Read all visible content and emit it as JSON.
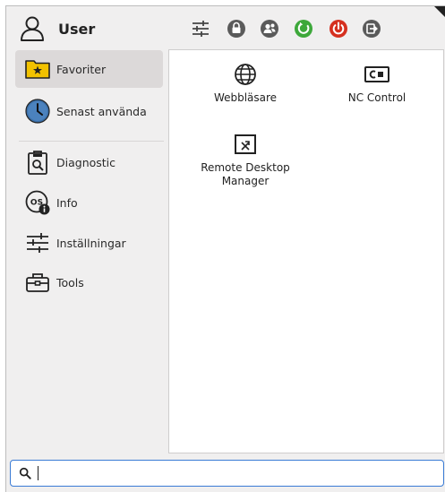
{
  "header": {
    "user_name": "User",
    "icons": [
      "settings-sliders-icon",
      "lock-icon",
      "switch-user-icon",
      "restart-icon",
      "power-icon",
      "logout-icon"
    ],
    "colors": {
      "restart": "#3da83a",
      "power": "#d5301f",
      "neutral": "#555555"
    }
  },
  "sidebar": {
    "items": [
      {
        "label": "Favoriter",
        "icon": "star-folder-icon",
        "selected": true
      },
      {
        "label": "Senast använda",
        "icon": "clock-icon",
        "selected": false
      },
      {
        "label": "Diagnostic",
        "icon": "clipboard-search-icon",
        "selected": false
      },
      {
        "label": "Info",
        "icon": "os-info-icon",
        "selected": false
      },
      {
        "label": "Inställningar",
        "icon": "sliders-icon",
        "selected": false
      },
      {
        "label": "Tools",
        "icon": "toolbox-icon",
        "selected": false
      }
    ]
  },
  "main": {
    "apps": [
      {
        "label": "Webbläsare",
        "icon": "globe-icon"
      },
      {
        "label": "NC Control",
        "icon": "nc-control-icon"
      },
      {
        "label": "Remote Desktop Manager",
        "icon": "remote-desktop-icon"
      }
    ]
  },
  "search": {
    "value": "",
    "placeholder": ""
  }
}
